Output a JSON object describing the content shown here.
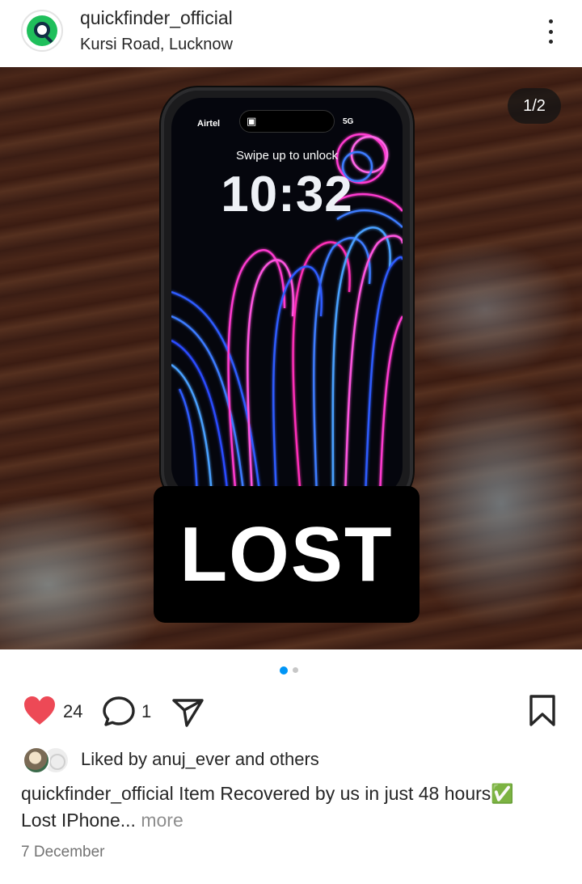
{
  "header": {
    "username": "quickfinder_official",
    "location": "Kursi Road, Lucknow",
    "avatar_icon": "magnifier-logo-icon",
    "menu_icon": "more-vertical-icon"
  },
  "post": {
    "page_counter": "1/2",
    "current_page": 1,
    "total_pages": 2,
    "sticker_text": "LOST",
    "phone_screen": {
      "carrier": "Airtel",
      "signal": "5G",
      "swipe_hint": "Swipe up to unlock",
      "time": "10:32"
    }
  },
  "actions": {
    "like_icon": "heart-filled-icon",
    "like_count": "24",
    "comment_icon": "comment-icon",
    "comment_count": "1",
    "share_icon": "send-icon",
    "save_icon": "bookmark-icon",
    "like_color": "#ed4956"
  },
  "liked_by": {
    "prefix": "Liked by ",
    "user": "anuj_ever",
    "suffix": " and others"
  },
  "caption": {
    "username": "quickfinder_official",
    "line1": " Item Recovered by us in just 48 hours✅",
    "line2": "Lost IPhone",
    "ellipsis": "...",
    "more": " more"
  },
  "date": "7 December",
  "colors": {
    "accent_blue": "#0095f6",
    "text": "#262626",
    "muted": "#737373"
  }
}
